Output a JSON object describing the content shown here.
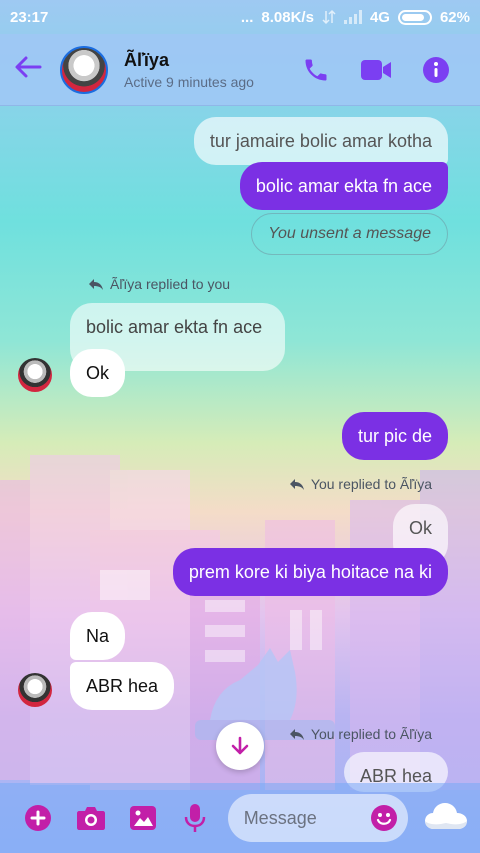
{
  "status_bar": {
    "time": "23:17",
    "dots": "...",
    "speed": "8.08K/s",
    "network": "4G",
    "battery": "62%"
  },
  "header": {
    "name": "Ãľïya",
    "status": "Active 9 minutes ago"
  },
  "messages": {
    "m1": "tur jamaire bolic amar kotha",
    "m2": "bolic amar ekta fn ace",
    "m3": "You unsent a message",
    "reply1": "Ãľïya replied to you",
    "m4": "bolic amar ekta fn ace",
    "m5": "Ok",
    "m6": "tur pic de",
    "reply2": "You replied to Ãľïya",
    "m7": "Ok",
    "m8": "prem kore ki biya hoitace na ki",
    "m9": "Na",
    "m10": "ABR hea",
    "reply3": "You replied to Ãľïya",
    "m11": "ABR hea"
  },
  "composer": {
    "placeholder": "Message"
  },
  "colors": {
    "accent": "#7b30e4",
    "icon_magenta": "#c21fa8",
    "header_bg": "#9ec8f4"
  },
  "icons": [
    "back-arrow-icon",
    "phone-icon",
    "video-icon",
    "info-icon",
    "reply-arrow-icon",
    "chevron-down-icon",
    "plus-icon",
    "camera-icon",
    "image-icon",
    "mic-icon",
    "emoji-icon",
    "cloud-icon"
  ]
}
